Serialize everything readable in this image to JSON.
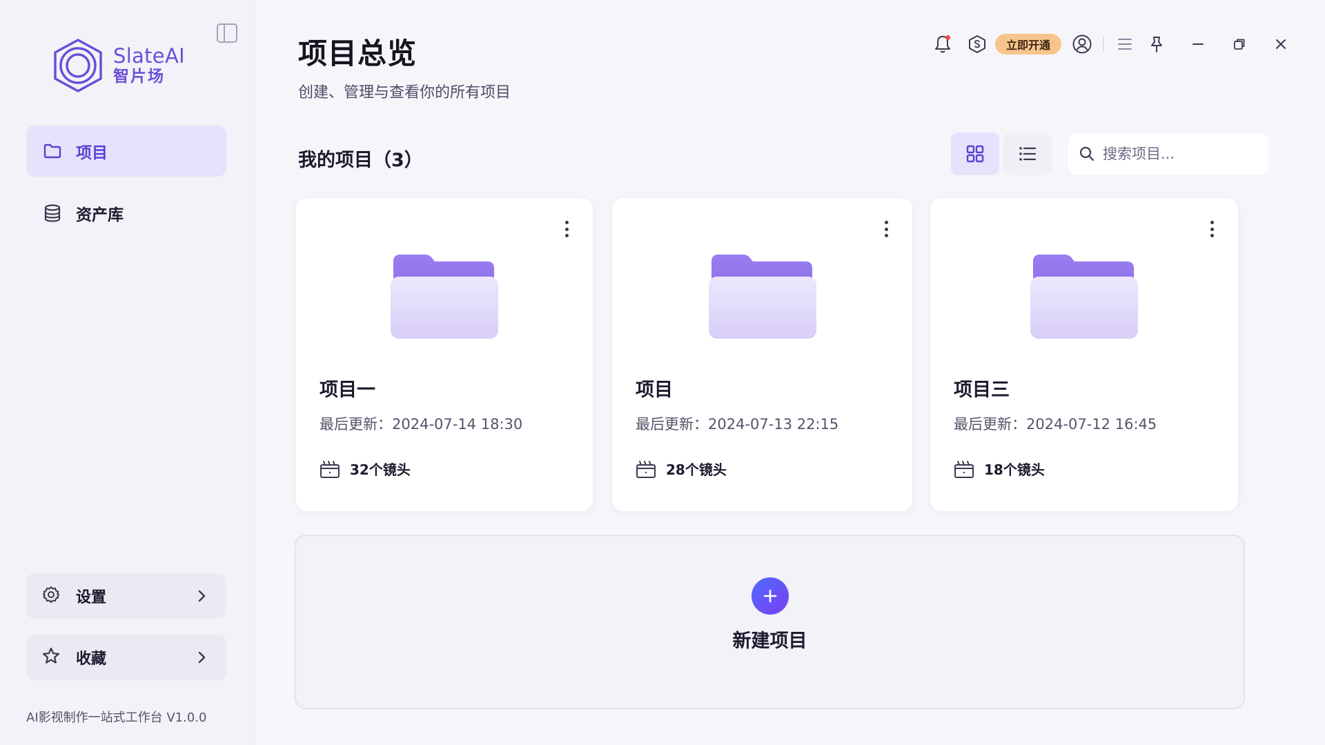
{
  "app": {
    "logo_en": "SlateAI",
    "logo_cn": "智片场",
    "version_text": "AI影视制作一站式工作台 V1.0.0"
  },
  "sidebar": {
    "items": [
      {
        "label": "项目",
        "icon": "folder-icon",
        "active": true
      },
      {
        "label": "资产库",
        "icon": "database-icon",
        "active": false
      }
    ],
    "bottom_items": [
      {
        "label": "设置",
        "icon": "gear-icon"
      },
      {
        "label": "收藏",
        "icon": "star-icon"
      }
    ]
  },
  "header": {
    "title": "项目总览",
    "subtitle": "创建、管理与查看你的所有项目",
    "vip_label": "立即开通"
  },
  "main": {
    "section_title": "我的项目（3）",
    "search_placeholder": "搜索项目...",
    "view_mode": "grid",
    "projects": [
      {
        "name": "项目一",
        "updated": "最后更新：2024-07-14 18:30",
        "shots": "32个镜头"
      },
      {
        "name": "项目",
        "updated": "最后更新：2024-07-13 22:15",
        "shots": "28个镜头"
      },
      {
        "name": "项目三",
        "updated": "最后更新：2024-07-12 16:45",
        "shots": "18个镜头"
      }
    ],
    "new_project_label": "新建项目"
  },
  "colors": {
    "accent": "#5b3fd4",
    "accent_light": "#e7e2fb",
    "vip": "#f7c58c",
    "notification_dot": "#f04848"
  }
}
